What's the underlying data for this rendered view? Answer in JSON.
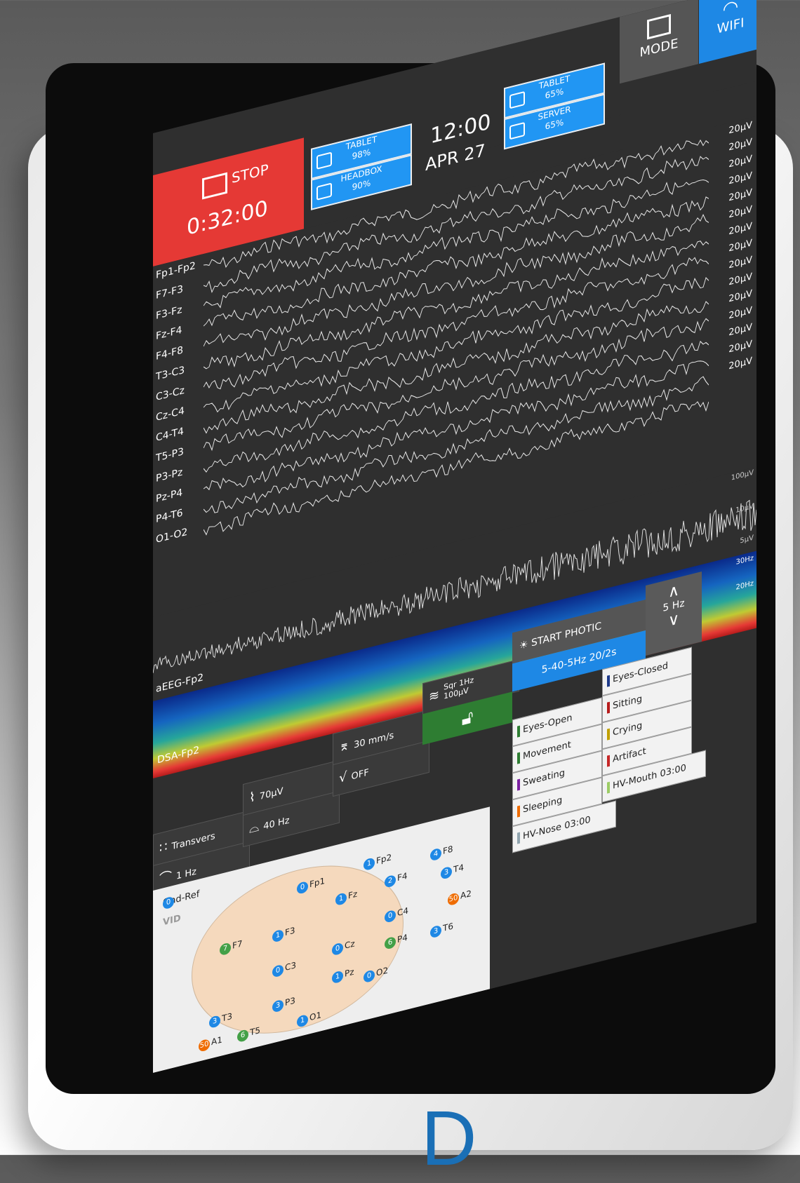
{
  "status": {
    "stop_label": "STOP",
    "timer": "0:32:00",
    "tablet_battery_label": "TABLET",
    "tablet_battery_pct": "98%",
    "headbox_battery_label": "HEADBOX",
    "headbox_battery_pct": "90%",
    "time": "12:00",
    "date": "APR 27",
    "tablet_storage_label": "TABLET",
    "tablet_storage_pct": "65%",
    "server_storage_label": "SERVER",
    "server_storage_pct": "65%",
    "mode_label": "MODE",
    "wifi_label": "WIFI"
  },
  "channels": [
    "Fp1-Fp2",
    "F7-F3",
    "F3-Fz",
    "Fz-F4",
    "F4-F8",
    "T3-C3",
    "C3-Cz",
    "Cz-C4",
    "C4-T4",
    "T5-P3",
    "P3-Pz",
    "Pz-P4",
    "P4-T6",
    "O1-O2"
  ],
  "scales": [
    "20µV",
    "20µV",
    "20µV",
    "20µV",
    "20µV",
    "20µV",
    "20µV",
    "20µV",
    "20µV",
    "20µV",
    "20µV",
    "20µV",
    "20µV",
    "20µV",
    "20µV"
  ],
  "aeeg": {
    "label": "aEEG-Fp2",
    "scale_top": "100µV",
    "scale_mid": "10µV",
    "scale_bottom": "5µV"
  },
  "dsa": {
    "label": "DSA-Fp2",
    "scale_top": "30Hz",
    "scale_mid": "20Hz"
  },
  "controls": {
    "montage": "Transvers",
    "sensitivity": "70µV",
    "speed": "30 mm/s",
    "test_signal_line1": "Sqr 1Hz",
    "test_signal_line2": "100µV",
    "low_filter": "1 Hz",
    "high_filter": "40 Hz",
    "notch": "OFF"
  },
  "photic": {
    "start_label": "START PHOTIC",
    "settings": "5-40-5Hz 20/2s",
    "freq": "5 Hz"
  },
  "markers": {
    "eyes_closed": "Eyes-Closed",
    "eyes_open": "Eyes-Open",
    "sitting": "Sitting",
    "movement": "Movement",
    "crying": "Crying",
    "sweating": "Sweating",
    "artifact": "Artifact",
    "sleeping": "Sleeping",
    "hv_mouth": "HV-Mouth",
    "hv_mouth_time": "03:00",
    "hv_nose": "HV-Nose",
    "hv_nose_time": "03:00"
  },
  "electrodes": {
    "gnd_label": "Gnd-Ref",
    "gnd_value": "0",
    "vid_label": "VID",
    "list": [
      {
        "name": "Fp1",
        "value": "0"
      },
      {
        "name": "Fp2",
        "value": "1"
      },
      {
        "name": "F8",
        "value": "4"
      },
      {
        "name": "Fz",
        "value": "1"
      },
      {
        "name": "F4",
        "value": "2"
      },
      {
        "name": "T4",
        "value": "3"
      },
      {
        "name": "F7",
        "value": "7"
      },
      {
        "name": "F3",
        "value": "1"
      },
      {
        "name": "C4",
        "value": "0"
      },
      {
        "name": "A2",
        "value": "50"
      },
      {
        "name": "Cz",
        "value": "0"
      },
      {
        "name": "C3",
        "value": "0"
      },
      {
        "name": "P4",
        "value": "6"
      },
      {
        "name": "T6",
        "value": "3"
      },
      {
        "name": "Pz",
        "value": "1"
      },
      {
        "name": "T3",
        "value": "3"
      },
      {
        "name": "P3",
        "value": "3"
      },
      {
        "name": "O2",
        "value": "0"
      },
      {
        "name": "A1",
        "value": "50"
      },
      {
        "name": "T5",
        "value": "6"
      },
      {
        "name": "O1",
        "value": "1"
      }
    ]
  },
  "colors": {
    "stop": "#e53935",
    "accent_blue": "#1e88e5",
    "lock_green": "#2e7d32",
    "brand": "#1a6fb6"
  }
}
